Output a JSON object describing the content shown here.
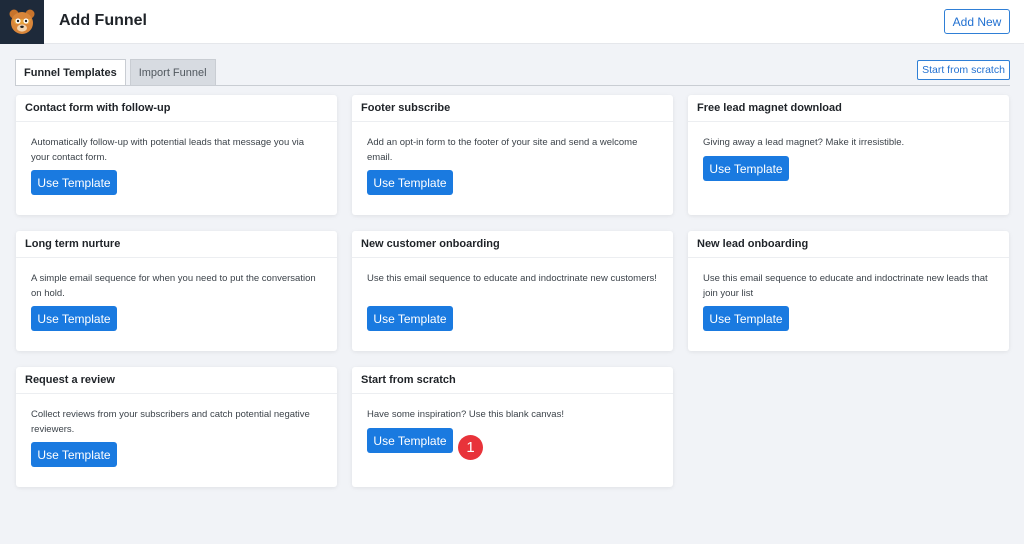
{
  "header": {
    "logo_icon": "bear-mascot-icon",
    "title": "Add Funnel",
    "add_new_label": "Add New"
  },
  "tabs": [
    {
      "label": "Funnel Templates",
      "active": true
    },
    {
      "label": "Import Funnel",
      "active": false
    }
  ],
  "start_from_scratch_label": "Start from scratch",
  "use_template_label": "Use Template",
  "cards": [
    {
      "title": "Contact form with follow-up",
      "description": "Automatically follow-up with potential leads that message you via your contact form."
    },
    {
      "title": "Footer subscribe",
      "description": "Add an opt-in form to the footer of your site and send a welcome email."
    },
    {
      "title": "Free lead magnet download",
      "description": "Giving away a lead magnet? Make it irresistible."
    },
    {
      "title": "Long term nurture",
      "description": "A simple email sequence for when you need to put the conversation on hold."
    },
    {
      "title": "New customer onboarding",
      "description": "Use this email sequence to educate and indoctrinate new customers!"
    },
    {
      "title": "New lead onboarding",
      "description": "Use this email sequence to educate and indoctrinate new leads that join your list"
    },
    {
      "title": "Request a review",
      "description": "Collect reviews from your subscribers and catch potential negative reviewers."
    },
    {
      "title": "Start from scratch",
      "description": "Have some inspiration? Use this blank canvas!"
    }
  ],
  "step_badge": "1",
  "colors": {
    "accent": "#1a7ae0",
    "badge": "#e8333a",
    "background": "#f1f3f7"
  }
}
